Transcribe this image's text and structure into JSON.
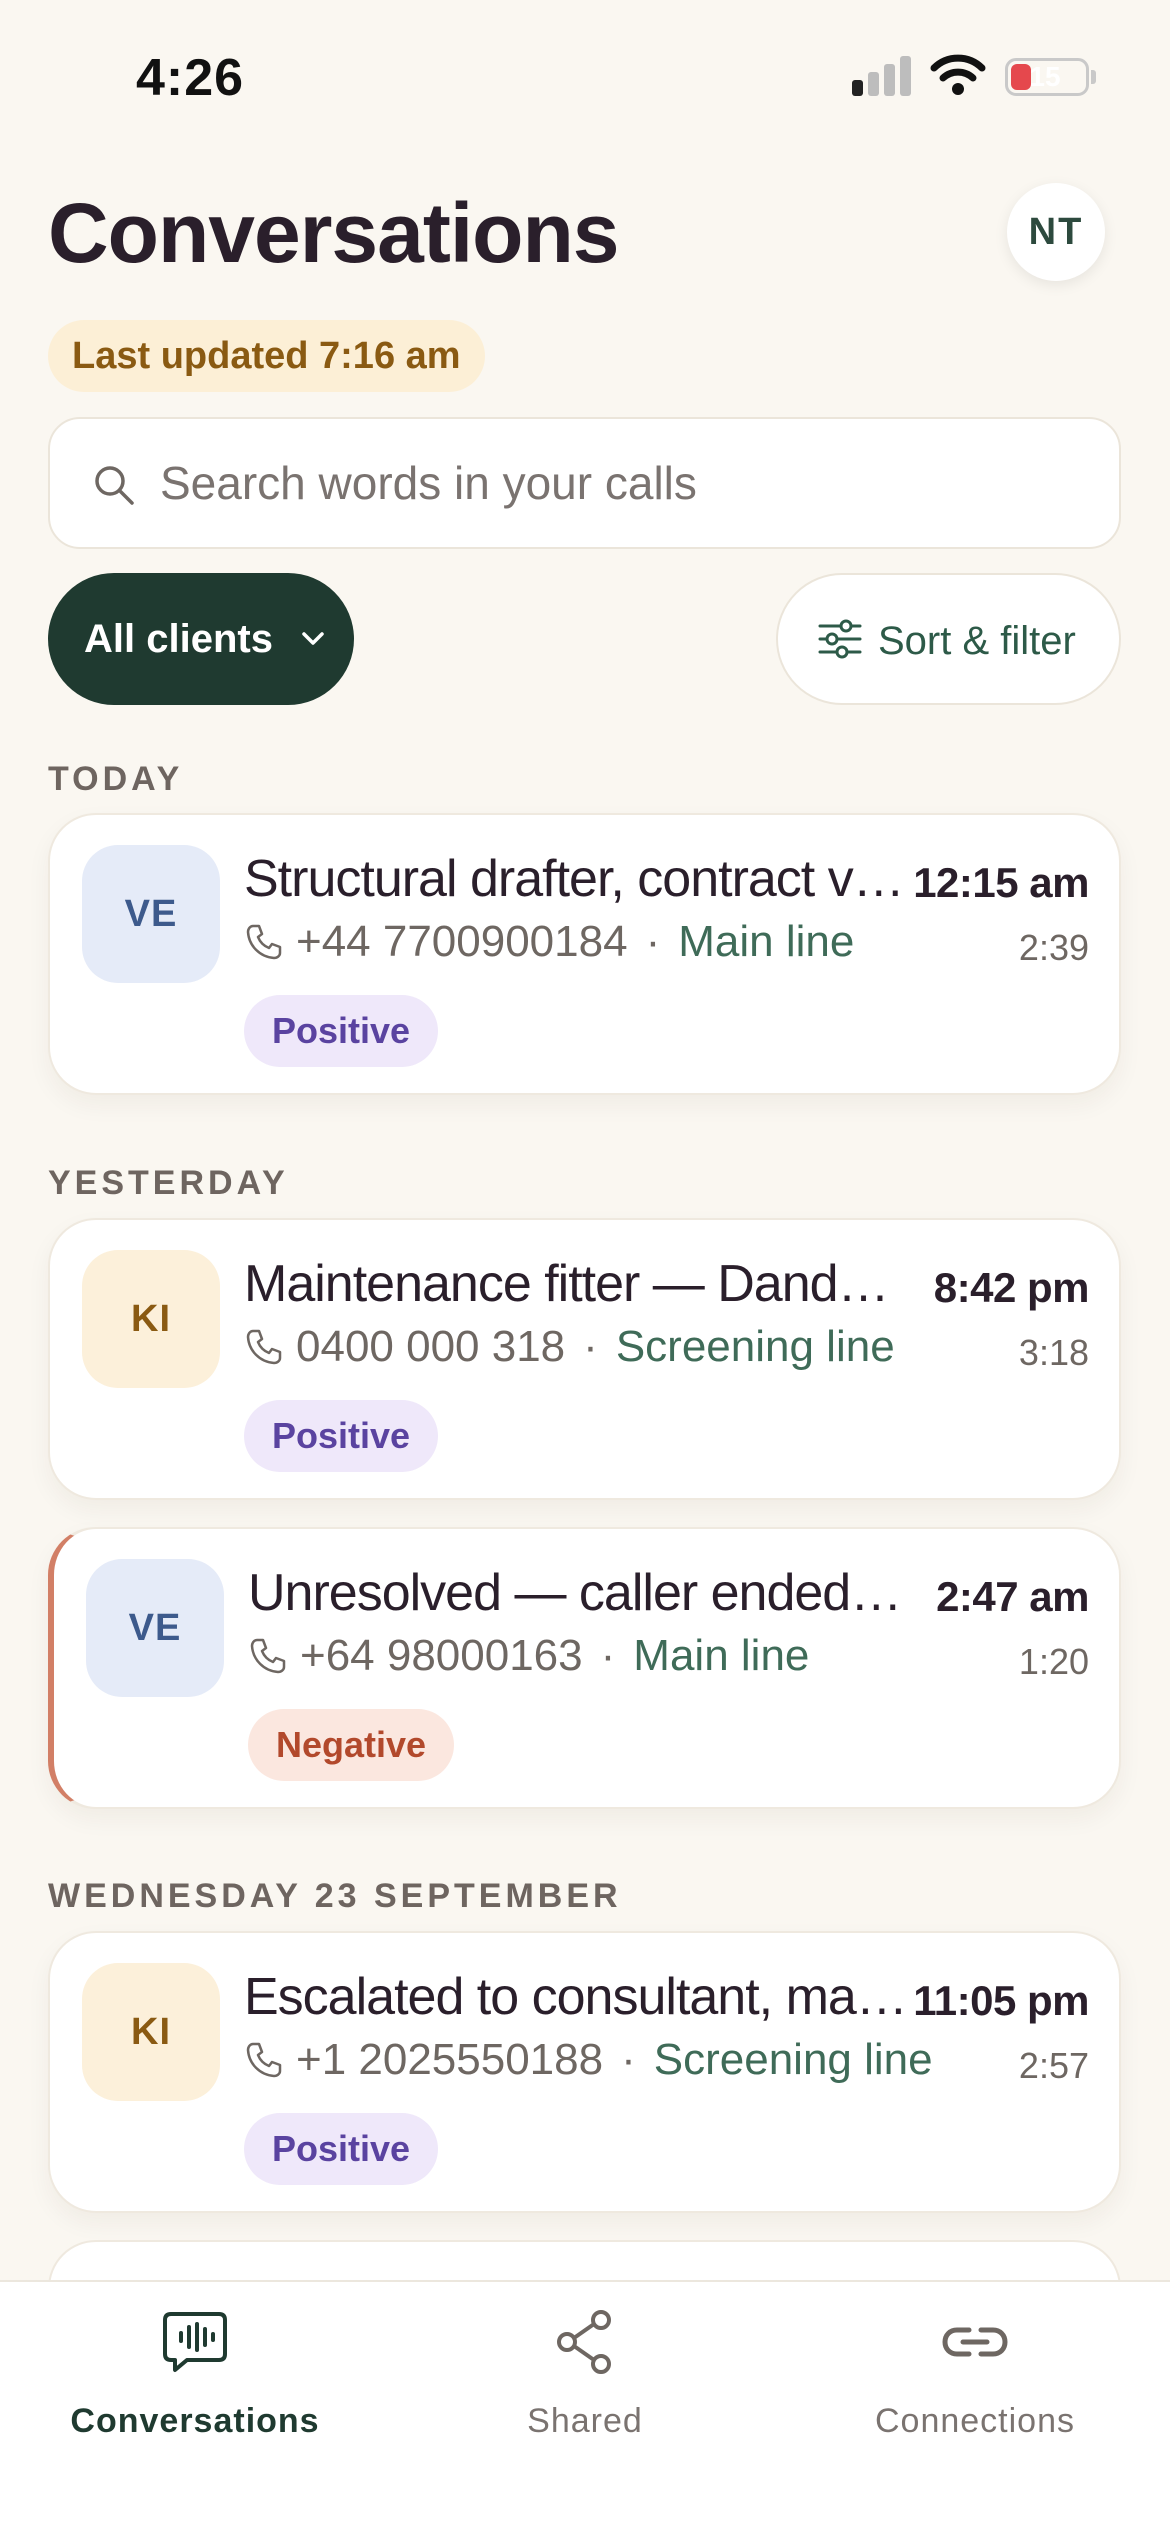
{
  "status_bar": {
    "time": "4:26",
    "battery": "15"
  },
  "header": {
    "title": "Conversations",
    "avatar_initials": "NT",
    "last_updated": "Last updated 7:16 am"
  },
  "search": {
    "placeholder": "Search words in your calls",
    "value": ""
  },
  "filters": {
    "clients_label": "All clients",
    "sort_label": "Sort & filter"
  },
  "sections": [
    {
      "label": "TODAY",
      "items": [
        {
          "initials": "VE",
          "title": "Structural drafter, contract vacancy",
          "time": "12:15 am",
          "phone": "+44 7700900184",
          "line": "Main line",
          "duration": "2:39",
          "sentiment": "Positive"
        }
      ]
    },
    {
      "label": "YESTERDAY",
      "items": [
        {
          "initials": "KI",
          "title": "Maintenance fitter — Dandenong site",
          "time": "8:42 pm",
          "phone": "0400 000 318",
          "line": "Screening line",
          "duration": "3:18",
          "sentiment": "Positive"
        },
        {
          "initials": "VE",
          "title": "Unresolved — caller ended the call",
          "time": "2:47 am",
          "phone": "+64 98000163",
          "line": "Main line",
          "duration": "1:20",
          "sentiment": "Negative"
        }
      ]
    },
    {
      "label": "WEDNESDAY 23 SEPTEMBER",
      "items": [
        {
          "initials": "KI",
          "title": "Escalated to consultant, manager callback",
          "time": "11:05 pm",
          "phone": "+1 2025550188",
          "line": "Screening line",
          "duration": "2:57",
          "sentiment": "Positive"
        }
      ]
    }
  ],
  "tabs": [
    {
      "label": "Conversations",
      "icon": "conversations-waveform-icon",
      "active": true
    },
    {
      "label": "Shared",
      "icon": "share-icon",
      "active": false
    },
    {
      "label": "Connections",
      "icon": "link-icon",
      "active": false
    }
  ],
  "colors": {
    "background": "#faf7f1",
    "accent_dark": "#1f3a30",
    "positive_badge": "#efe8fa",
    "negative_badge": "#fbe7df",
    "negative_accent": "#d27f66"
  }
}
